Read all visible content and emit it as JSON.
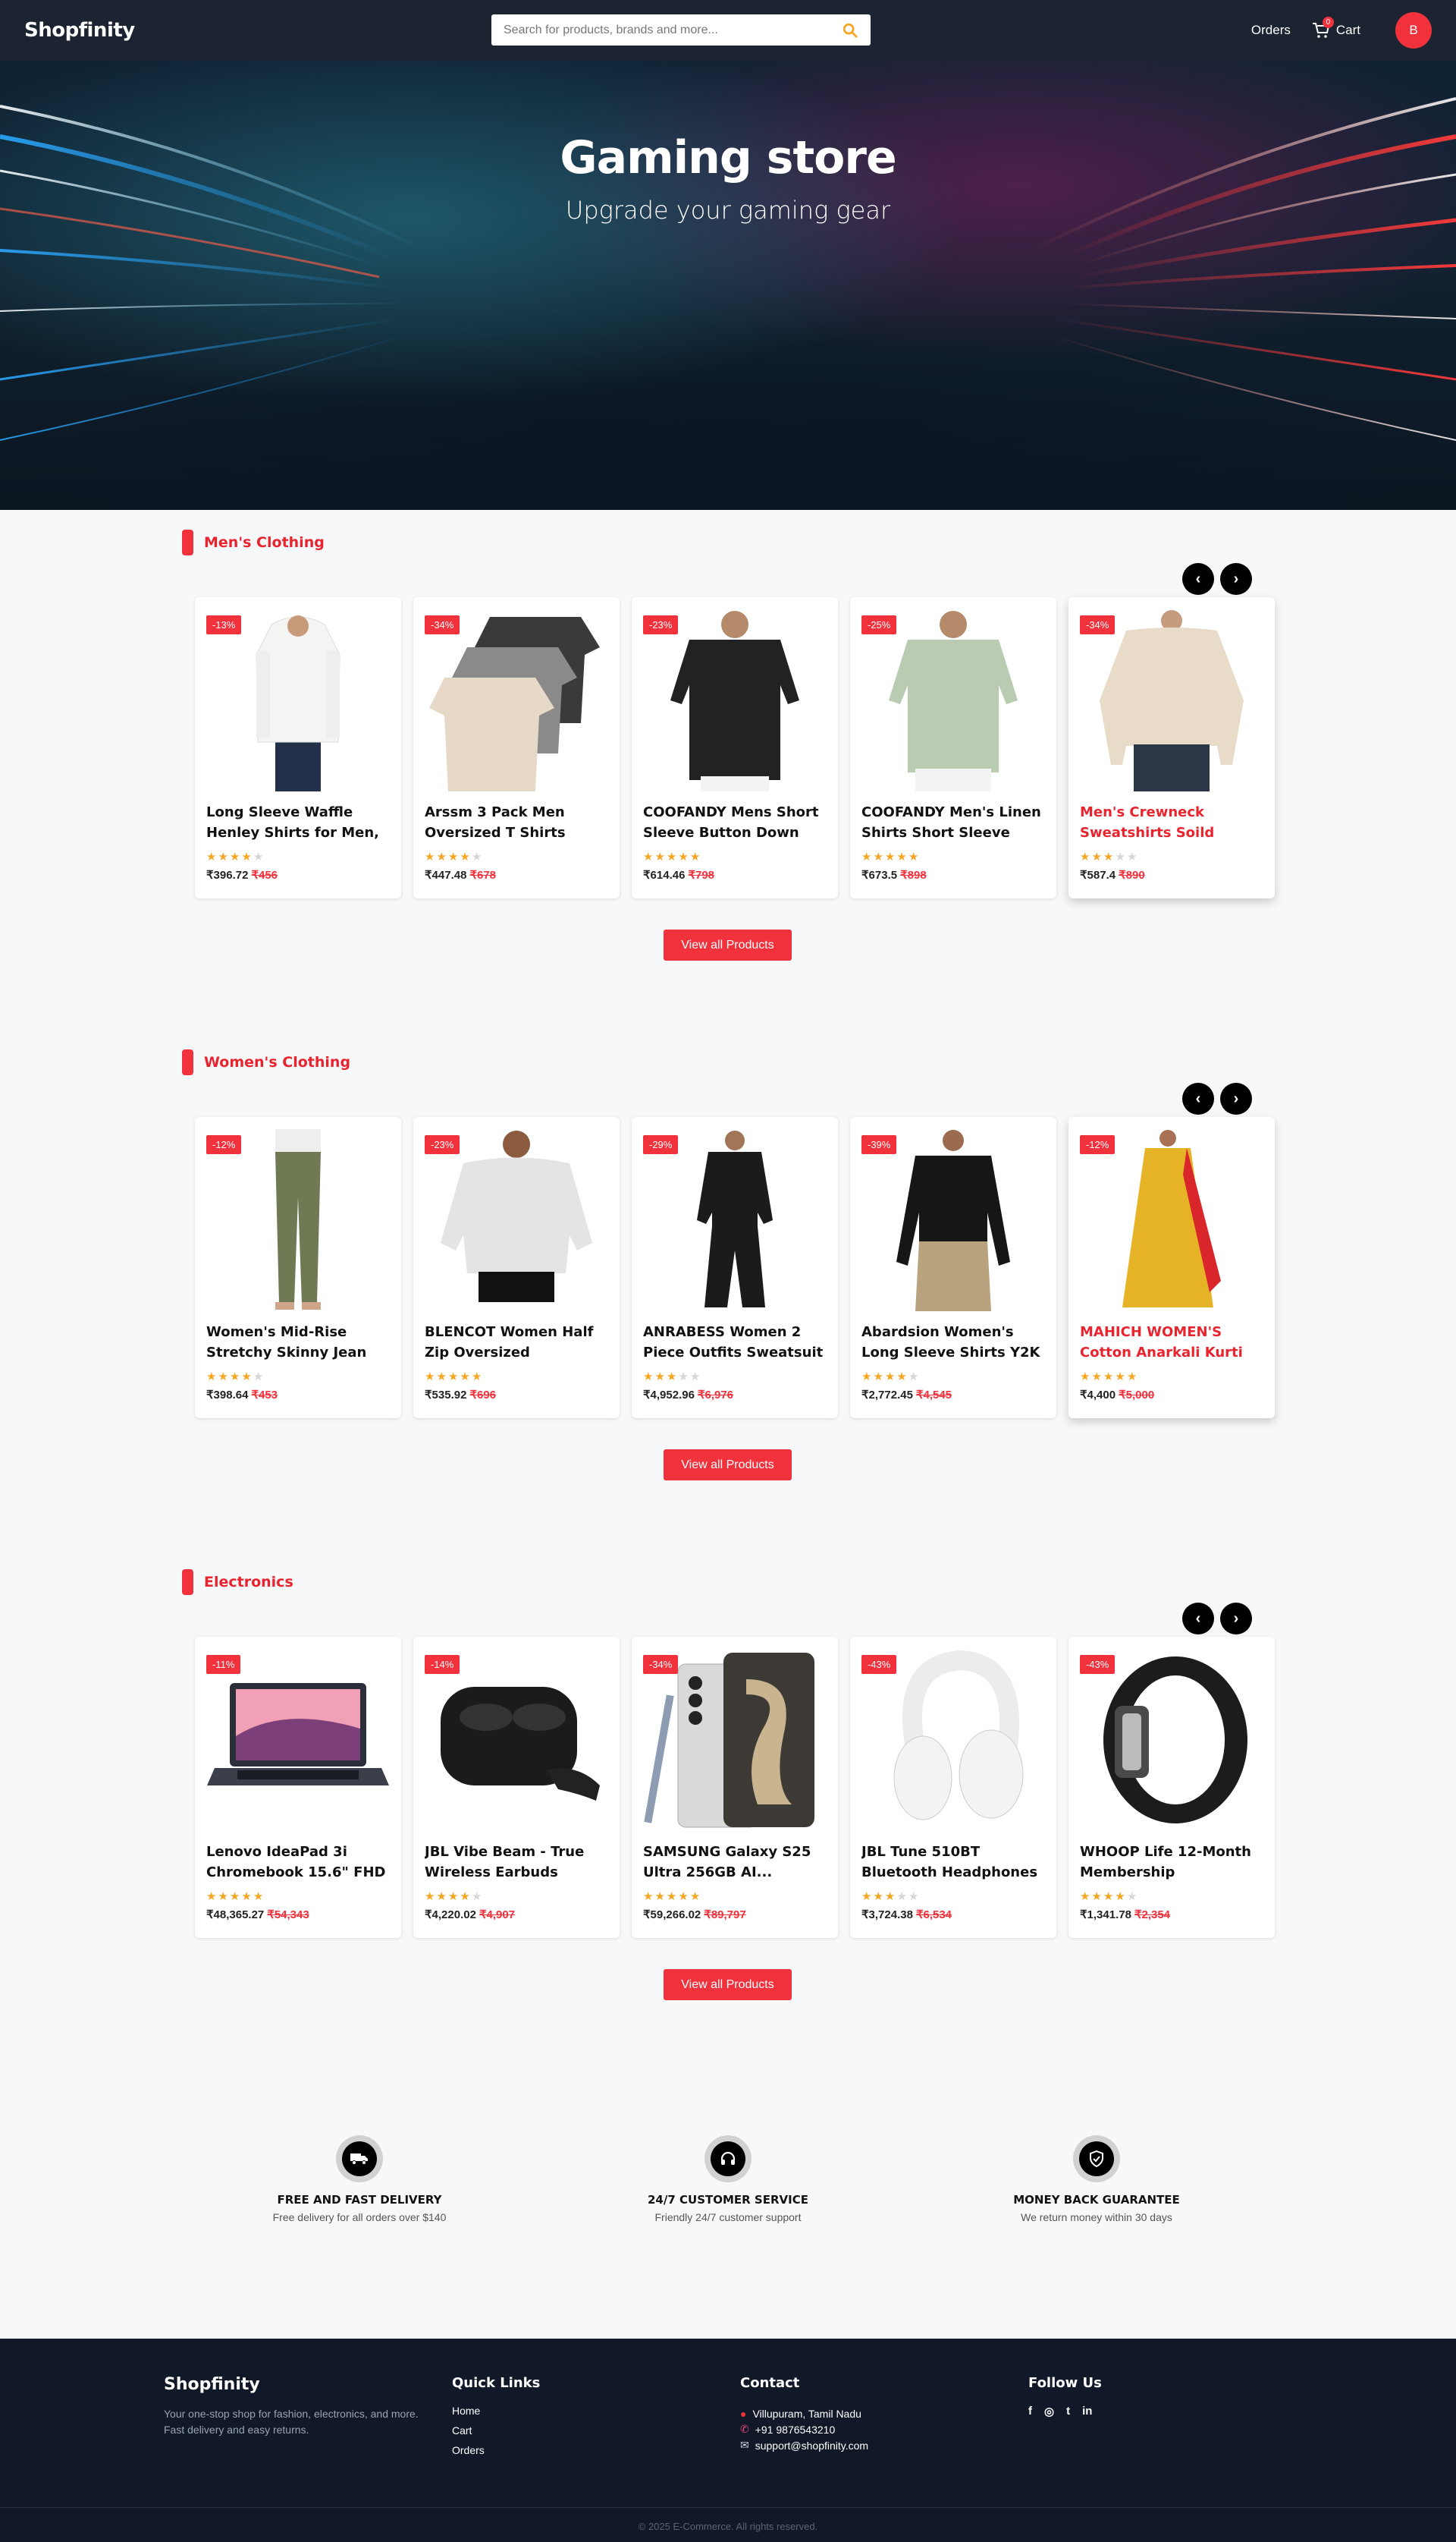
{
  "header": {
    "logo": "Shopfinity",
    "search_placeholder": "Search for products, brands and more...",
    "orders": "Orders",
    "cart": "Cart",
    "cart_count": "0",
    "avatar": "B"
  },
  "hero": {
    "title": "Gaming store",
    "subtitle": "Upgrade your gaming gear"
  },
  "sections": [
    {
      "title": "Men's Clothing",
      "view_all": "View all Products",
      "products": [
        {
          "discount": "-13%",
          "name": "Long Sleeve Waffle Henley Shirts for Men, Slim-Fit",
          "rating": 4,
          "price": "₹396.72",
          "old_price": "₹456"
        },
        {
          "discount": "-34%",
          "name": "Arssm 3 Pack Men Oversized T Shirts Vintag...",
          "rating": 4,
          "price": "₹447.48",
          "old_price": "₹678"
        },
        {
          "discount": "-23%",
          "name": "COOFANDY Mens Short Sleeve Button Down Shirt...",
          "rating": 5,
          "price": "₹614.46",
          "old_price": "₹798"
        },
        {
          "discount": "-25%",
          "name": "COOFANDY Men's Linen Shirts Short Sleeve Casu...",
          "rating": 5,
          "price": "₹673.5",
          "old_price": "₹898"
        },
        {
          "discount": "-34%",
          "name": "Men's Crewneck Sweatshirts Soild Color...",
          "rating": 3,
          "price": "₹587.4",
          "old_price": "₹890"
        }
      ]
    },
    {
      "title": "Women's Clothing",
      "view_all": "View all Products",
      "products": [
        {
          "discount": "-12%",
          "name": "Women's Mid-Rise Stretchy Skinny Jean",
          "rating": 4,
          "price": "₹398.64",
          "old_price": "₹453"
        },
        {
          "discount": "-23%",
          "name": "BLENCOT Women Half Zip Oversized Sweatshirts",
          "rating": 5,
          "price": "₹535.92",
          "old_price": "₹696"
        },
        {
          "discount": "-29%",
          "name": "ANRABESS Women 2 Piece Outfits Sweatsuit",
          "rating": 3,
          "price": "₹4,952.96",
          "old_price": "₹6,976"
        },
        {
          "discount": "-39%",
          "name": "Abardsion Women's Long Sleeve Shirts Y2K",
          "rating": 4,
          "price": "₹2,772.45",
          "old_price": "₹4,545"
        },
        {
          "discount": "-12%",
          "name": "MAHICH WOMEN'S Cotton Anarkali Kurti Set",
          "rating": 5,
          "price": "₹4,400",
          "old_price": "₹5,000"
        }
      ]
    },
    {
      "title": "Electronics",
      "view_all": "View all Products",
      "products": [
        {
          "discount": "-11%",
          "name": "Lenovo IdeaPad 3i Chromebook 15.6\" FHD",
          "rating": 5,
          "price": "₹48,365.27",
          "old_price": "₹54,343"
        },
        {
          "discount": "-14%",
          "name": "JBL Vibe Beam - True Wireless Earbuds",
          "rating": 4,
          "price": "₹4,220.02",
          "old_price": "₹4,907"
        },
        {
          "discount": "-34%",
          "name": "SAMSUNG Galaxy S25 Ultra 256GB AI...",
          "rating": 5,
          "price": "₹59,266.02",
          "old_price": "₹89,797"
        },
        {
          "discount": "-43%",
          "name": "JBL Tune 510BT Bluetooth Headphones",
          "rating": 3,
          "price": "₹3,724.38",
          "old_price": "₹6,534"
        },
        {
          "discount": "-43%",
          "name": "WHOOP Life 12-Month Membership",
          "rating": 4,
          "price": "₹1,341.78",
          "old_price": "₹2,354"
        }
      ]
    }
  ],
  "features": [
    {
      "icon": "delivery-truck-icon",
      "title": "FREE AND FAST DELIVERY",
      "desc": "Free delivery for all orders over $140"
    },
    {
      "icon": "headset-icon",
      "title": "24/7 CUSTOMER SERVICE",
      "desc": "Friendly 24/7 customer support"
    },
    {
      "icon": "shield-check-icon",
      "title": "MONEY BACK GUARANTEE",
      "desc": "We return money within 30 days"
    }
  ],
  "footer": {
    "brand": "Shopfinity",
    "tagline": "Your one-stop shop for fashion, electronics, and more. Fast delivery and easy returns.",
    "quick_links_title": "Quick Links",
    "quick_links": [
      "Home",
      "Cart",
      "Orders"
    ],
    "contact_title": "Contact",
    "address": "Villupuram, Tamil Nadu",
    "phone": "+91 9876543210",
    "email": "support@shopfinity.com",
    "follow_title": "Follow Us",
    "social": [
      "f",
      "◎",
      "t",
      "in"
    ],
    "copyright": "© 2025 E-Commerce. All rights reserved."
  },
  "colors": {
    "accent": "#f1313c",
    "header": "#1c2331",
    "footer": "#111827",
    "star": "#f5a623"
  }
}
